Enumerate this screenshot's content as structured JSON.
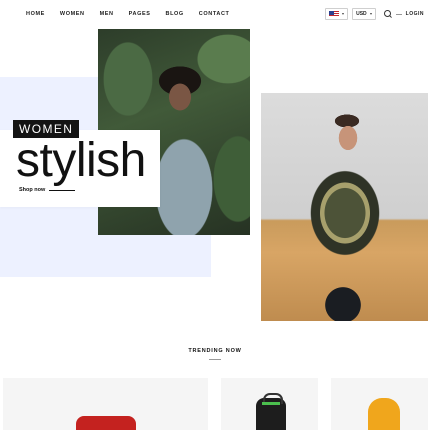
{
  "nav": {
    "items": [
      "HOME",
      "WOMEN",
      "MEN",
      "PAGES",
      "BLOG",
      "CONTACT"
    ]
  },
  "header": {
    "currency": "USD",
    "login_label": "LOGIN",
    "icons": [
      "us-flag-icon",
      "chevron-down-icon",
      "search-icon"
    ]
  },
  "hero": {
    "tag": "WOMEN",
    "headline": "stylish",
    "cta": "Shop now"
  },
  "trending": {
    "title": "TRENDING NOW"
  },
  "colors": {
    "panel_blue": "#edf1ff",
    "label_black": "#141414"
  }
}
